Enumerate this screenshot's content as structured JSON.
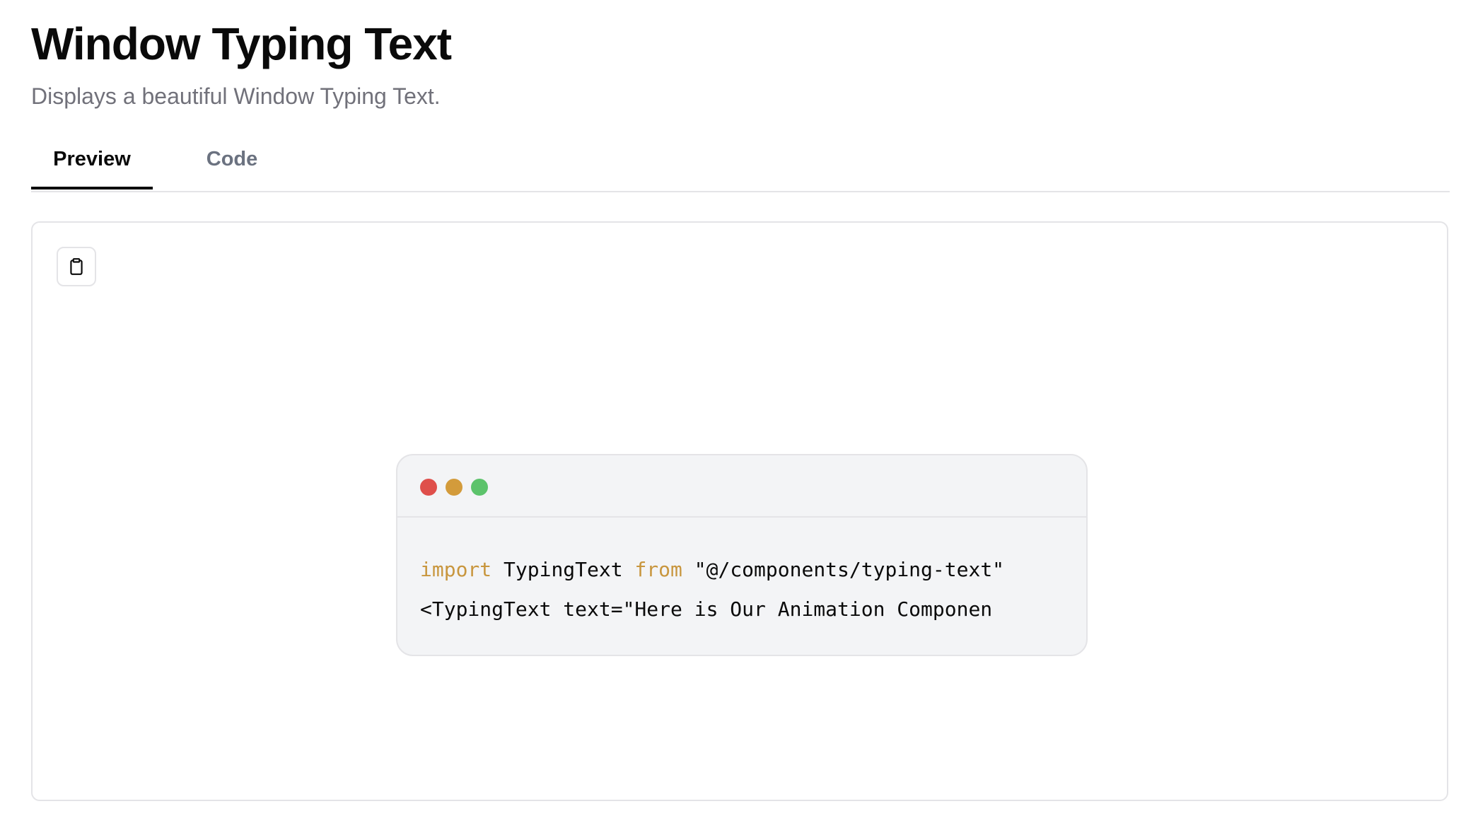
{
  "header": {
    "title": "Window Typing Text",
    "subtitle": "Displays a beautiful Window Typing Text."
  },
  "tabs": [
    {
      "label": "Preview",
      "active": true
    },
    {
      "label": "Code",
      "active": false
    }
  ],
  "preview": {
    "copy_icon": "clipboard-icon",
    "window": {
      "dots": [
        {
          "name": "close",
          "color": "#df4f4b"
        },
        {
          "name": "minimize",
          "color": "#d39b3b"
        },
        {
          "name": "maximize",
          "color": "#5cc36b"
        }
      ],
      "code_line_1": {
        "kw_import": "import",
        "name": " TypingText ",
        "kw_from": "from",
        "path": " \"@/components/typing-text\""
      },
      "code_line_2": "<TypingText text=\"Here is Our Animation Componen"
    }
  },
  "colors": {
    "keyword": "#c8963e",
    "border": "#e4e4e7",
    "window_bg": "#f3f4f6",
    "muted_text": "#71717a"
  }
}
